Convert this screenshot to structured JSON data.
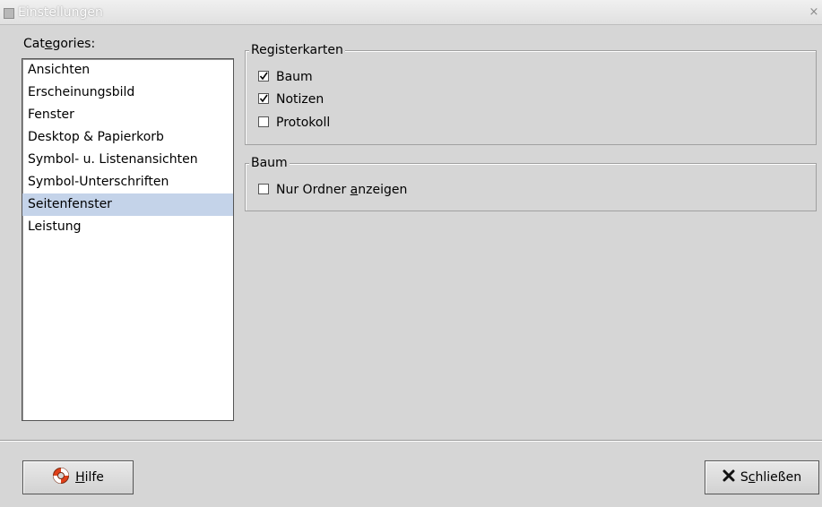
{
  "window": {
    "title": "Einstellungen",
    "close_glyph": "×"
  },
  "categories": {
    "label_prefix": "Cat",
    "label_mnemonic": "e",
    "label_suffix": "gories:",
    "items": [
      {
        "label": "Ansichten",
        "selected": false
      },
      {
        "label": "Erscheinungsbild",
        "selected": false
      },
      {
        "label": "Fenster",
        "selected": false
      },
      {
        "label": "Desktop & Papierkorb",
        "selected": false
      },
      {
        "label": "Symbol- u. Listenansichten",
        "selected": false
      },
      {
        "label": "Symbol-Unterschriften",
        "selected": false
      },
      {
        "label": "Seitenfenster",
        "selected": true
      },
      {
        "label": "Leistung",
        "selected": false
      }
    ],
    "selected_color": "#c4d3e9"
  },
  "tabs_group": {
    "title": "Registerkarten",
    "options": [
      {
        "label": "Baum",
        "checked": true
      },
      {
        "label": "Notizen",
        "checked": true
      },
      {
        "label": "Protokoll",
        "checked": false
      }
    ]
  },
  "tree_group": {
    "title": "Baum",
    "option_prefix": "Nur Ordner ",
    "option_mnemonic": "a",
    "option_suffix": "nzeigen",
    "option_checked": false
  },
  "buttons": {
    "help_mnemonic": "H",
    "help_rest": "ilfe",
    "help_icon": "lifebuoy-icon",
    "close_first": "S",
    "close_mnemonic": "c",
    "close_rest": "hließen",
    "close_icon": "x-icon"
  }
}
